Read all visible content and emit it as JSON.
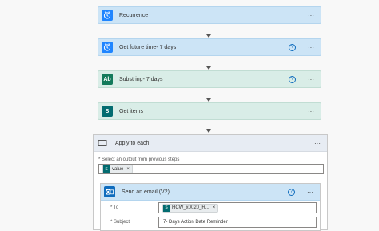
{
  "steps": [
    {
      "title": "Recurrence",
      "icon": "clock-icon",
      "has_help": false
    },
    {
      "title": "Get future time- 7 days",
      "icon": "clock-icon",
      "has_help": true
    },
    {
      "title": "Substring- 7 days",
      "icon": "text-icon",
      "has_help": true
    },
    {
      "title": "Get items",
      "icon": "sharepoint-icon",
      "has_help": false
    }
  ],
  "icons": {
    "text_glyph": "Ab",
    "sp_glyph": "S"
  },
  "menu_glyph": "···",
  "help_glyph": "?",
  "apply_to_each": {
    "title": "Apply to each",
    "field_label": "* Select an output from previous steps",
    "token": "value",
    "token_remove": "×"
  },
  "send_email": {
    "title": "Send an email (V2)",
    "to_label": "* To",
    "to_token": "HCW_x0020_R...",
    "to_remove": "×",
    "subject_label": "* Subject",
    "subject_value": "7- Days Action Date Reminder"
  },
  "colors": {
    "blue_card": "#cce4f6",
    "green_card": "#d9ede7",
    "accent": "#0f6cbd"
  }
}
